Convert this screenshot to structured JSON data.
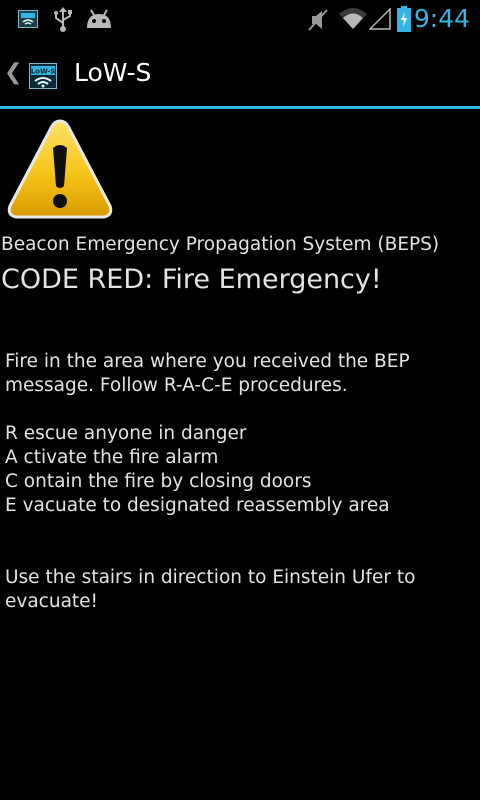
{
  "status_bar": {
    "time": "9:44",
    "left_icons": [
      "app-notification-icon",
      "usb-icon",
      "android-debug-icon"
    ],
    "right_icons": [
      "vibrate-off-icon",
      "wifi-icon",
      "signal-icon",
      "battery-icon"
    ]
  },
  "action_bar": {
    "up_caret": "❮",
    "logo_text": "LoW-S",
    "title": "LoW-S"
  },
  "content": {
    "system_name": "Beacon Emergency Propagation System (BEPS)",
    "alert_title": "CODE RED: Fire Emergency!",
    "message_lines": [
      "Fire in the area where you received the BEP",
      "message. Follow R-A-C-E procedures."
    ],
    "race_steps": [
      "R escue anyone in danger",
      "A ctivate the fire alarm",
      "C ontain the fire by closing doors",
      "E vacuate to designated reassembly area"
    ],
    "instruction_lines": [
      "Use the stairs in direction to Einstein Ufer to",
      "evacuate!"
    ]
  },
  "colors": {
    "accent": "#33b5e5",
    "background": "#000000",
    "text": "#e3e3e3",
    "warning_fill": "#f5c518"
  }
}
